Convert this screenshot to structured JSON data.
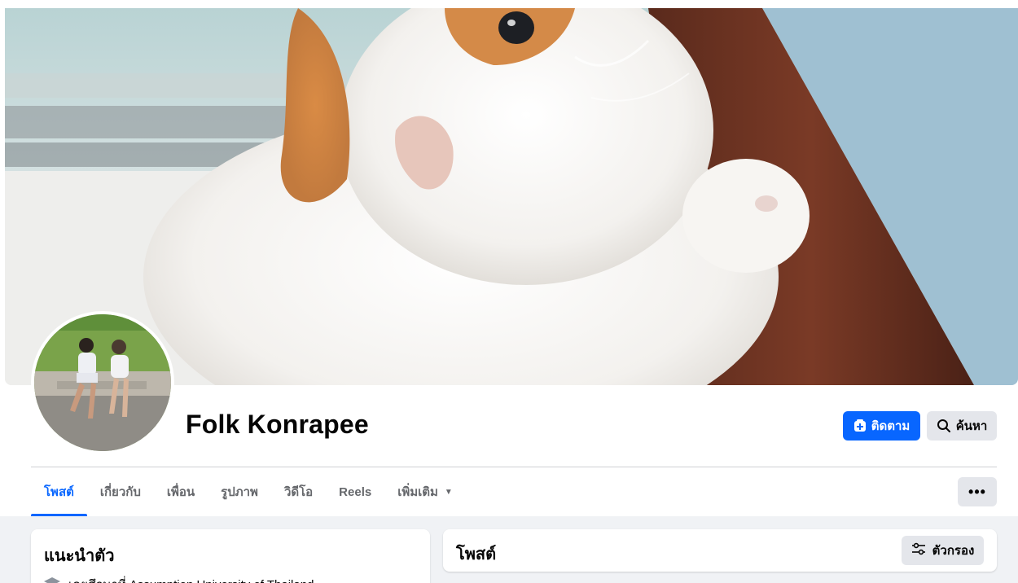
{
  "profile": {
    "name": "Folk Konrapee"
  },
  "actions": {
    "follow_label": "ติดตาม",
    "search_label": "ค้นหา",
    "more_label": "•••"
  },
  "tabs": [
    {
      "label": "โพสต์",
      "active": true
    },
    {
      "label": "เกี่ยวกับ",
      "active": false
    },
    {
      "label": "เพื่อน",
      "active": false
    },
    {
      "label": "รูปภาพ",
      "active": false
    },
    {
      "label": "วิดีโอ",
      "active": false
    },
    {
      "label": "Reels",
      "active": false
    },
    {
      "label": "เพิ่มเติม",
      "active": false
    }
  ],
  "intro": {
    "title": "แนะนำตัว",
    "education": "เคยศึกษาที่ Assumption University of Thailand"
  },
  "posts": {
    "title": "โพสต์",
    "filter_label": "ตัวกรอง"
  },
  "icons": {
    "follow": "follow-plus-icon",
    "search": "search-icon",
    "filter": "filter-sliders-icon",
    "education": "graduation-cap-icon",
    "dropdown": "chevron-down-icon"
  },
  "colors": {
    "accent": "#0866ff",
    "secondary_button": "#e4e6eb",
    "background": "#f0f2f5",
    "muted_text": "#65676b"
  }
}
